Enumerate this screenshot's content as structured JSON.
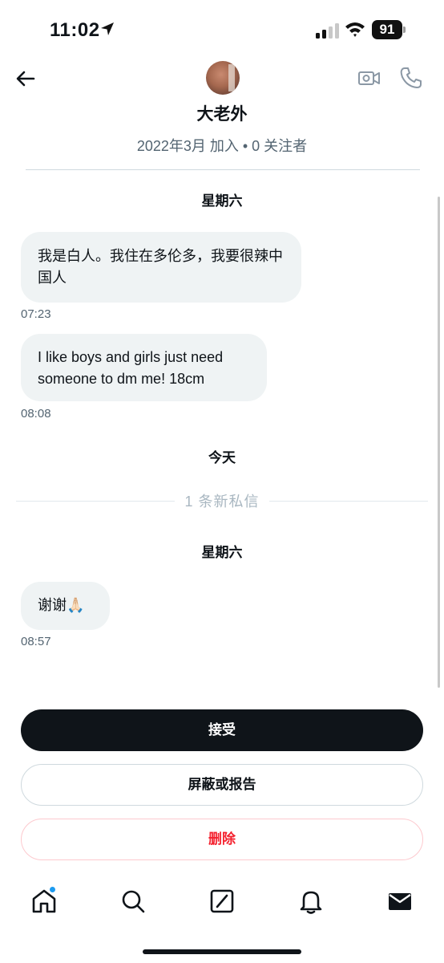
{
  "status_bar": {
    "time": "11:02",
    "battery": "91",
    "icons": [
      "location-arrow-icon",
      "cellular-signal-icon",
      "wifi-icon",
      "battery-icon"
    ]
  },
  "header": {
    "name": "大老外",
    "meta": "2022年3月 加入 • 0 关注者",
    "icons": [
      "back-arrow-icon",
      "video-call-icon",
      "phone-call-icon"
    ]
  },
  "conversation": {
    "day_1": "星期六",
    "messages": [
      {
        "text": "我是白人。我住在多伦多，我要很辣中国人",
        "time": "07:23"
      },
      {
        "text": "I like boys and girls just need someone to dm me! 18cm",
        "time": "08:08"
      }
    ],
    "today_label": "今天",
    "new_message_label": "1 条新私信",
    "day_2": "星期六",
    "new_messages": [
      {
        "text": "谢谢🙏🏻",
        "time": "08:57"
      }
    ]
  },
  "actions": {
    "accept": "接受",
    "block_or_report": "屏蔽或报告",
    "delete": "删除"
  },
  "tab_bar": {
    "items": [
      "home-icon",
      "search-icon",
      "grok-icon",
      "notifications-icon",
      "messages-icon"
    ],
    "home_has_badge": true
  },
  "colors": {
    "primary": "#0f1419",
    "secondary_text": "#536471",
    "bubble": "#eff3f4",
    "danger": "#f4212e",
    "accent": "#1d9bf0"
  }
}
